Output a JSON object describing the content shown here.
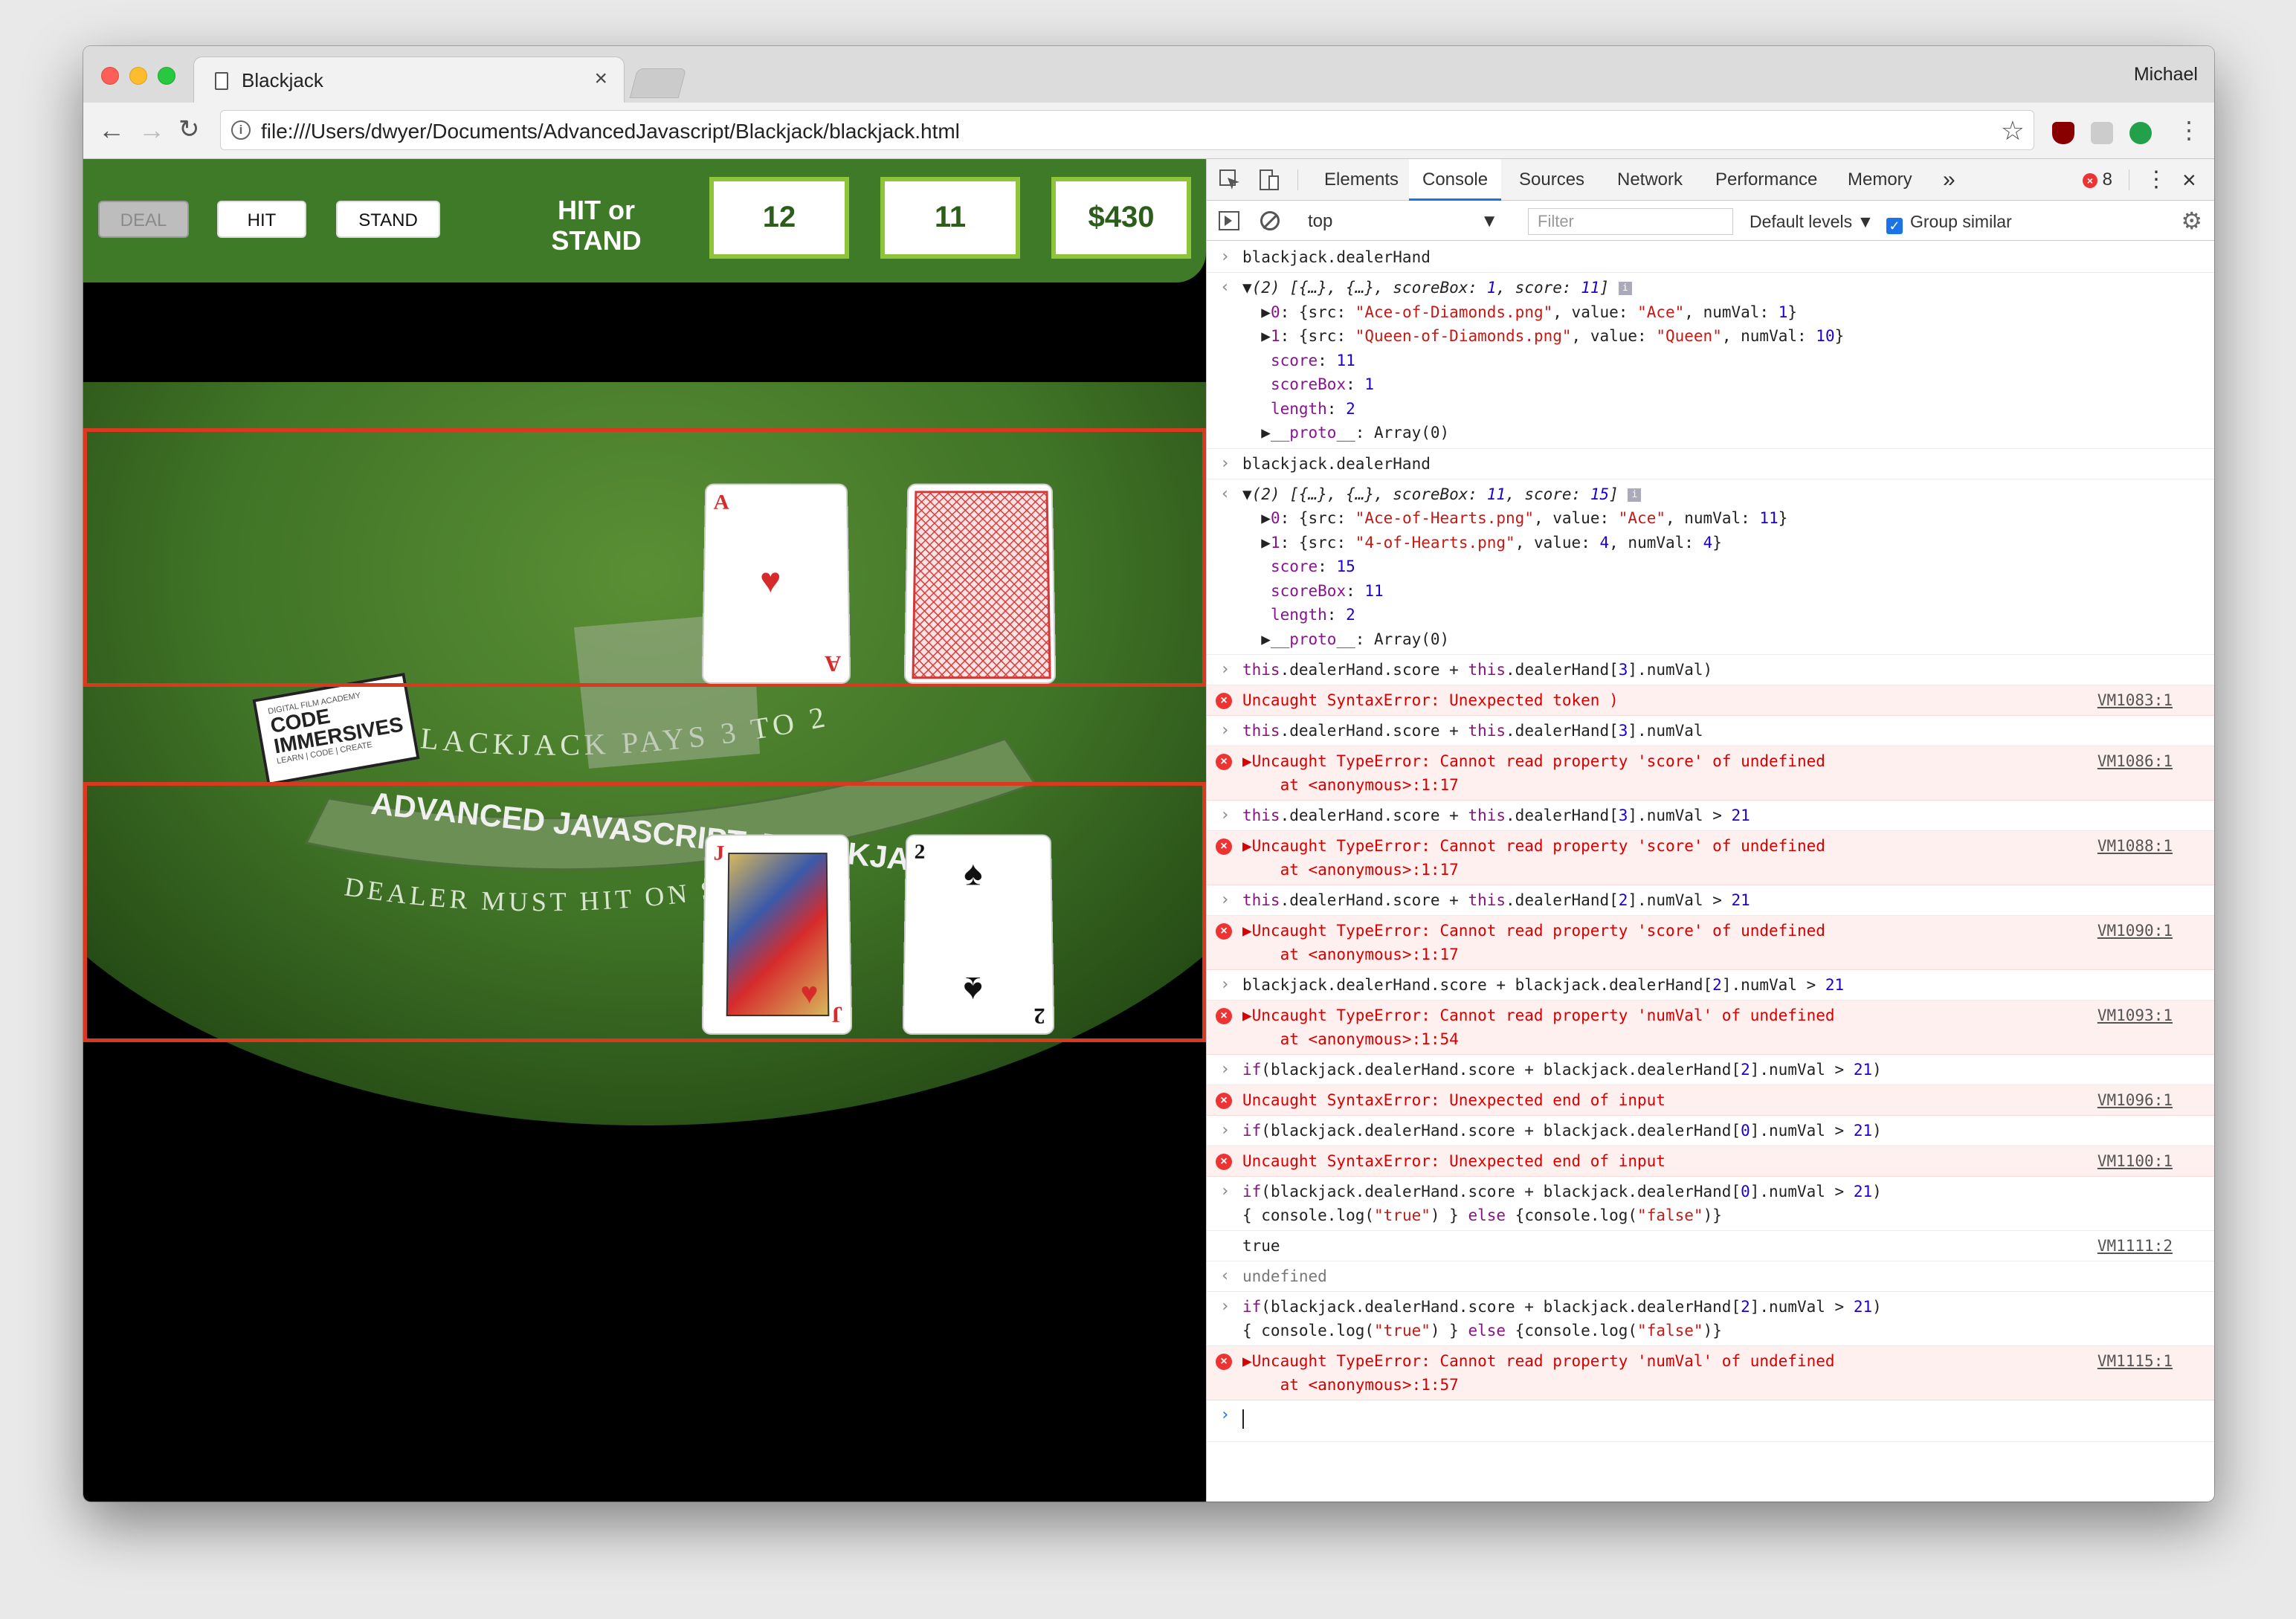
{
  "window": {
    "user_name": "Michael"
  },
  "tab": {
    "title": "Blackjack"
  },
  "addressbar": {
    "url": "file:///Users/dwyer/Documents/AdvancedJavascript/Blackjack/blackjack.html"
  },
  "game": {
    "buttons": {
      "deal": "DEAL",
      "hit": "HIT",
      "stand": "STAND"
    },
    "prompt_line1": "HIT or",
    "prompt_line2": "STAND",
    "dealer_score": "12",
    "player_score": "11",
    "bank": "$430",
    "table_text": {
      "arc_top": "BLACKJACK PAYS 3 TO 2",
      "banner": "ADVANCED JAVASCRIPT: BLACKJACK",
      "arc_bottom": "DEALER MUST HIT ON SOFT 17"
    },
    "sign": {
      "small": "DIGITAL FILM ACADEMY",
      "big1": "CODE",
      "big2": "IMMERSIVES",
      "tagline": "LEARN | CODE | CREATE"
    },
    "dealer_cards": [
      {
        "rank": "A",
        "suit": "♥",
        "color": "#d62b2b"
      }
    ],
    "player_cards": [
      {
        "rank": "J",
        "suit": "♥",
        "color": "#d62b2b"
      },
      {
        "rank": "2",
        "suit": "♠",
        "color": "#111111"
      }
    ]
  },
  "devtools": {
    "tabs": [
      "Elements",
      "Console",
      "Sources",
      "Network",
      "Performance",
      "Memory"
    ],
    "more": "»",
    "error_count": "8",
    "context": "top",
    "filter_placeholder": "Filter",
    "levels": "Default levels ▼",
    "group_similar": "Group similar"
  },
  "colors": {
    "accent": "#1a73e8",
    "error": "#d60000",
    "felt": "#3f7a29",
    "score_border": "#8ec43a",
    "hand_outline": "#d93a1f"
  }
}
